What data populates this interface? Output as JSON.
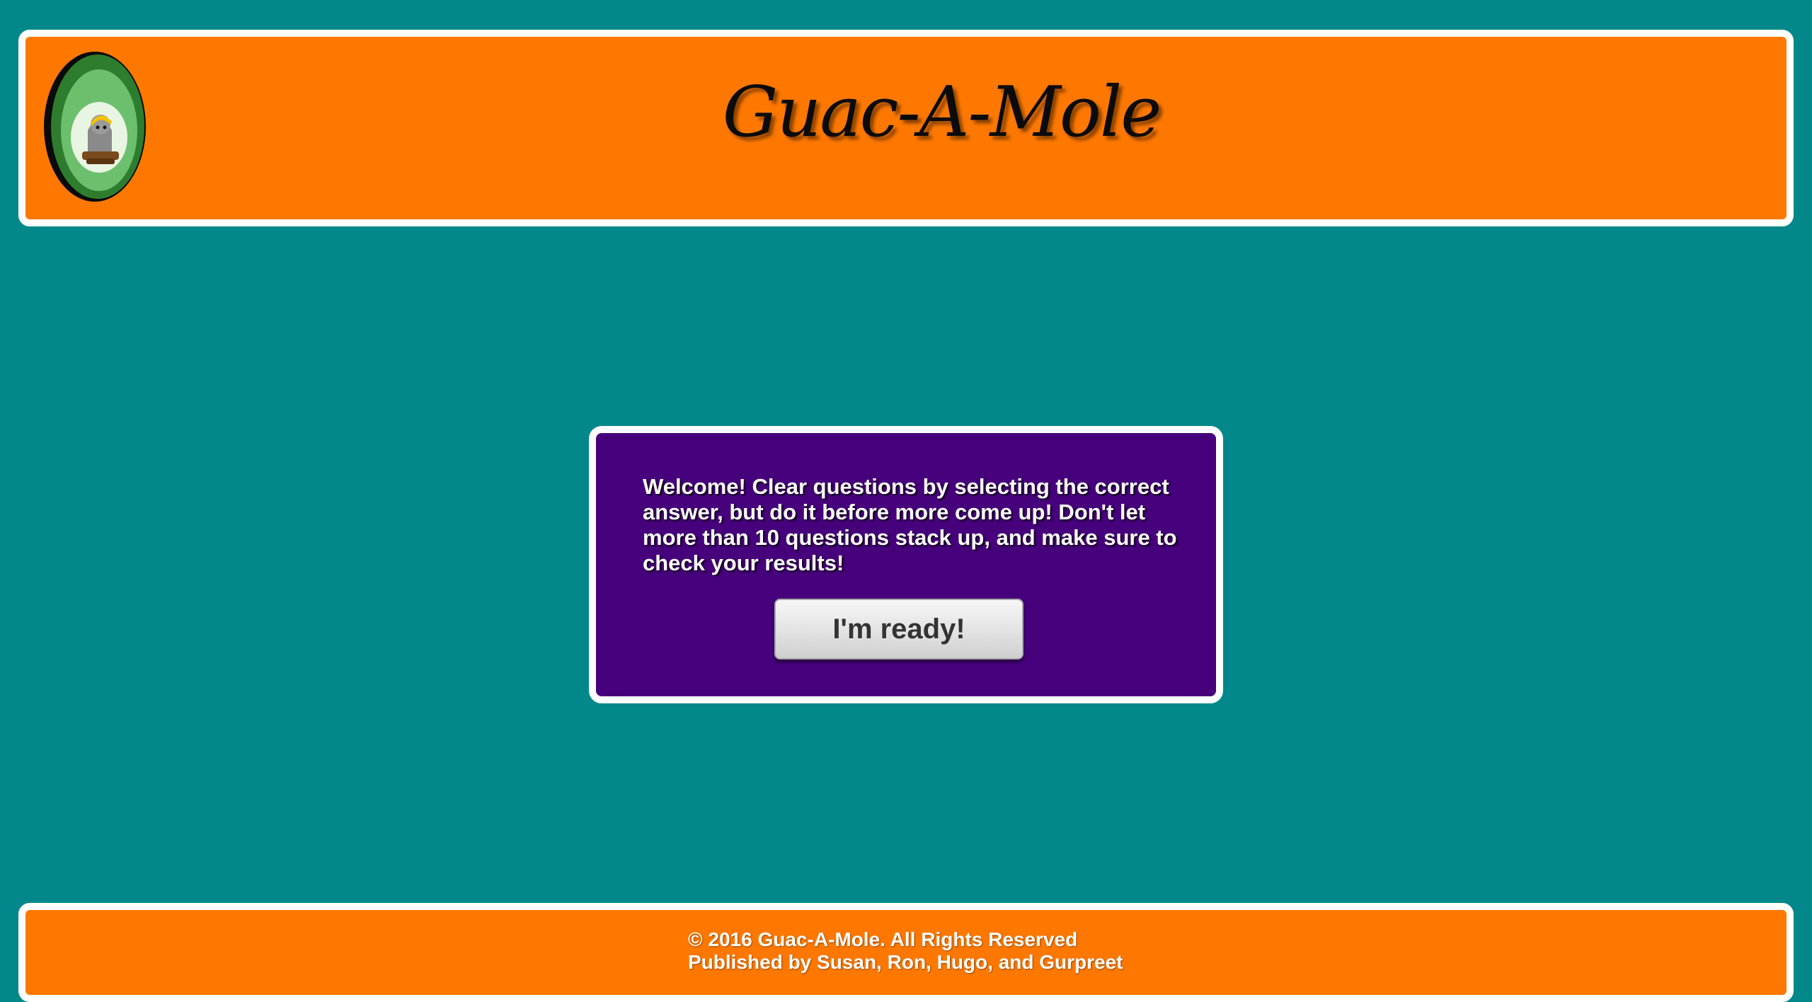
{
  "header": {
    "title": "Guac-A-Mole",
    "logo_icon": "avocado-mole-logo-icon"
  },
  "welcome": {
    "message": "Welcome! Clear questions by selecting the correct answer, but do it before more come up! Don't let more than 10 questions stack up, and make sure to check your results!",
    "button_label": "I'm ready!"
  },
  "footer": {
    "copyright": "© 2016 Guac-A-Mole. All Rights Reserved",
    "published_by": "Published by Susan, Ron, Hugo, and Gurpreet"
  },
  "colors": {
    "background": "#02888a",
    "banner": "#fe7800",
    "panel": "#46007b",
    "border": "#ffffff"
  }
}
